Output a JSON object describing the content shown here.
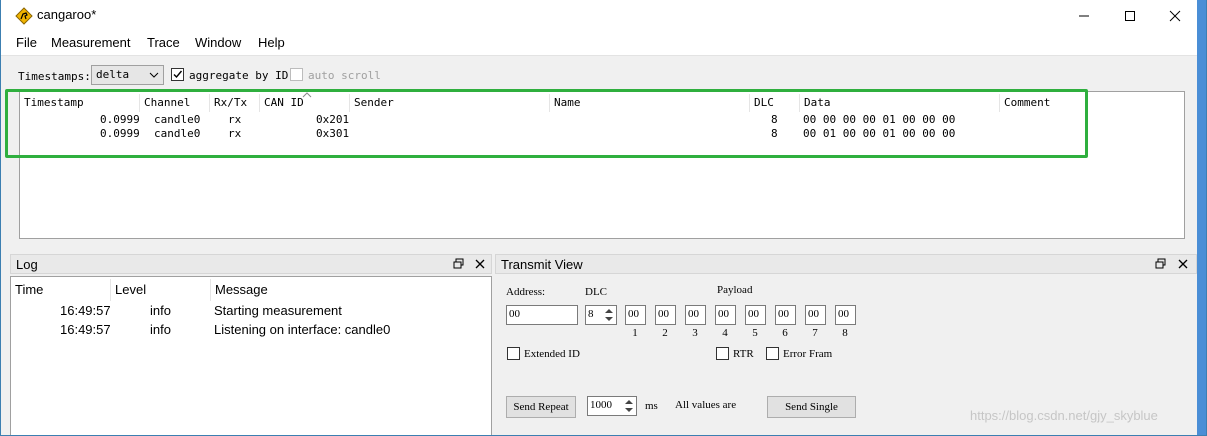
{
  "window": {
    "title": "cangaroo*"
  },
  "menu": [
    "File",
    "Measurement",
    "Trace",
    "Window",
    "Help"
  ],
  "toolbar": {
    "timestamps_label": "Timestamps:",
    "timestamps_value": "delta",
    "aggregate_label": "aggregate by ID",
    "aggregate_checked": true,
    "autoscroll_label": "auto scroll",
    "autoscroll_checked": false
  },
  "trace": {
    "columns": [
      "Timestamp",
      "Channel",
      "Rx/Tx",
      "CAN ID",
      "Sender",
      "Name",
      "DLC",
      "Data",
      "Comment"
    ],
    "rows": [
      {
        "timestamp": "0.0999",
        "channel": "candle0",
        "rxtx": "rx",
        "canid": "0x201",
        "sender": "",
        "name": "",
        "dlc": "8",
        "data": "00 00 00 00 01 00 00 00",
        "comment": ""
      },
      {
        "timestamp": "0.0999",
        "channel": "candle0",
        "rxtx": "rx",
        "canid": "0x301",
        "sender": "",
        "name": "",
        "dlc": "8",
        "data": "00 01 00 00 01 00 00 00",
        "comment": ""
      }
    ]
  },
  "log": {
    "title": "Log",
    "columns": [
      "Time",
      "Level",
      "Message"
    ],
    "rows": [
      {
        "time": "16:49:57",
        "level": "info",
        "message": "Starting measurement"
      },
      {
        "time": "16:49:57",
        "level": "info",
        "message": "Listening on interface: candle0"
      }
    ]
  },
  "transmit": {
    "title": "Transmit View",
    "address_label": "Address:",
    "address_value": "00",
    "dlc_label": "DLC",
    "dlc_value": "8",
    "payload_label": "Payload",
    "payload": [
      "00",
      "00",
      "00",
      "00",
      "00",
      "00",
      "00",
      "00"
    ],
    "payload_index": [
      "1",
      "2",
      "3",
      "4",
      "5",
      "6",
      "7",
      "8"
    ],
    "extended_label": "Extended ID",
    "rtr_label": "RTR",
    "error_label": "Error Fram",
    "send_repeat_label": "Send Repeat",
    "interval_value": "1000",
    "ms_label": "ms",
    "all_values_label": "All values are",
    "send_single_label": "Send Single"
  },
  "watermark": "https://blog.csdn.net/gjy_skyblue",
  "colors": {
    "highlight": "#2faf3e",
    "accent": "#4a8ed6"
  }
}
